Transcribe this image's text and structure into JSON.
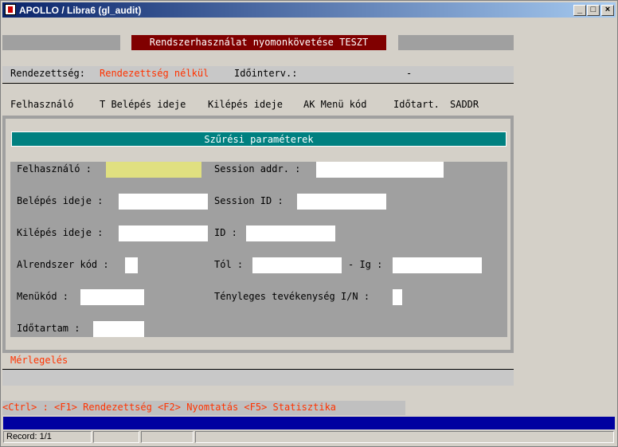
{
  "window": {
    "title": "APOLLO / Libra6 (gl_audit)"
  },
  "header": {
    "title": "Rendszerhasználat nyomonkövetése TESZT"
  },
  "info": {
    "order_label": "Rendezettség:",
    "order_value": "Rendezettség nélkül",
    "interval_label": "Időinterv.:",
    "interval_sep": "-"
  },
  "columns": [
    "Felhasználó",
    "T Belépés ideje",
    "Kilépés ideje",
    "AK Menü kód",
    "Időtart.",
    "SADDR"
  ],
  "filter": {
    "banner": "Szűrési paraméterek",
    "user_label": "Felhasználó :",
    "login_label": "Belépés ideje :",
    "logout_label": "Kilépés ideje :",
    "subsystem_label": "Alrendszer kód :",
    "menu_label": "Menükód :",
    "duration_label": "Időtartam :",
    "session_addr_label": "Session addr. :",
    "session_id_label": "Session ID :",
    "id_label": "ID :",
    "from_label": "Tól :",
    "to_label": "- Ig :",
    "actual_label": "Tényleges tevékenység I/N :"
  },
  "summary_label": "Mérlegelés",
  "shortcuts": "<Ctrl> : <F1> Rendezettség <F2> Nyomtatás <F5> Statisztika",
  "statusbar": {
    "record": "Record: 1/1"
  }
}
